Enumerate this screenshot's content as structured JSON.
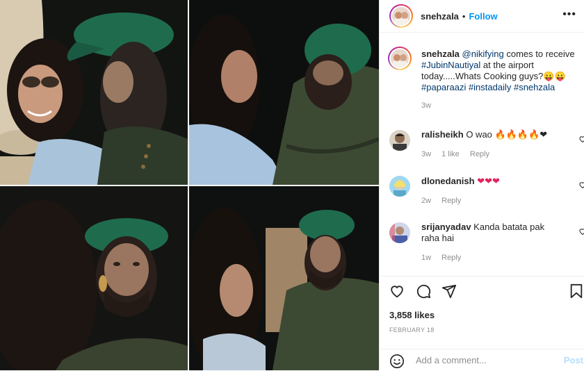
{
  "post": {
    "username": "snehzala",
    "follow_label": "Follow",
    "caption_user": "snehzala",
    "caption_mention": "@nikifying",
    "caption_text_1": "comes to receive",
    "caption_tag_1": "#JubinNautiyal",
    "caption_text_2": "at the airport today.....Whats Cooking guys?😛😛",
    "caption_tag_2": "#paparaazi #instadaily #snehzala",
    "caption_time": "3w"
  },
  "comments": [
    {
      "user": "ralisheikh",
      "text": "O wao 🔥🔥🔥🔥❤",
      "time": "3w",
      "likes": "1 like",
      "reply": "Reply"
    },
    {
      "user": "dlonedanish",
      "text": "❤❤❤",
      "time": "2w",
      "reply": "Reply"
    },
    {
      "user": "srijanyadav",
      "text": "Kanda batata pak raha hai",
      "time": "1w",
      "reply": "Reply"
    }
  ],
  "stats": {
    "likes": "3,858 likes",
    "date": "FEBRUARY 18"
  },
  "add_comment": {
    "placeholder": "Add a comment...",
    "post_label": "Post"
  },
  "icons": [
    "heart-icon",
    "comment-icon",
    "share-icon",
    "bookmark-icon",
    "emoji-icon"
  ],
  "colors": {
    "accent": "#0095f6",
    "text": "#262626",
    "muted": "#8e8e8e",
    "link": "#00376b",
    "cap_green": "#1f6b4e",
    "jacket_green": "#3d4a33"
  }
}
